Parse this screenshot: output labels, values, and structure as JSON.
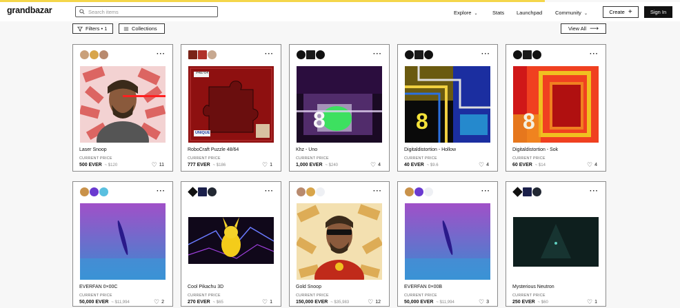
{
  "header": {
    "logo": "grandbazar",
    "search_placeholder": "Search items",
    "nav": {
      "explore": "Explore",
      "stats": "Stats",
      "launchpad": "Launchpad",
      "community": "Community"
    },
    "create_label": "Create",
    "signin_label": "Sign In"
  },
  "toolbar": {
    "filters_label": "Filters • 1",
    "collections_label": "Collections",
    "view_all_label": "View All"
  },
  "colors": {
    "accent": "#f4d64a",
    "dark": "#111111"
  },
  "cards": [
    {
      "title": "Laser Snoop",
      "price_label": "CURRENT PRICE",
      "price": "500 EVER",
      "usd": "~ $120",
      "likes": "11"
    },
    {
      "title": "RoboCraft Puzzle 48/64",
      "price_label": "CURRENT PRICE",
      "price": "777 EVER",
      "usd": "~ $186",
      "likes": "1"
    },
    {
      "title": "Khz - Uno",
      "price_label": "CURRENT PRICE",
      "price": "1,000 EVER",
      "usd": "~ $240",
      "likes": "4"
    },
    {
      "title": "Digitaldistortion - Hollow",
      "price_label": "CURRENT PRICE",
      "price": "40 EVER",
      "usd": "~ $9.6",
      "likes": "4"
    },
    {
      "title": "Digitaldistortion - Sok",
      "price_label": "CURRENT PRICE",
      "price": "60 EVER",
      "usd": "~ $14",
      "likes": "4"
    },
    {
      "title": "EVERFAN 0×00C",
      "price_label": "CURRENT PRICE",
      "price": "50,000 EVER",
      "usd": "~ $11,994",
      "likes": "2"
    },
    {
      "title": "Cool Pikachu 3D",
      "price_label": "CURRENT PRICE",
      "price": "270 EVER",
      "usd": "~ $65",
      "likes": "1"
    },
    {
      "title": "Gold Snoop",
      "price_label": "CURRENT PRICE",
      "price": "150,000 EVER",
      "usd": "~ $35,983",
      "likes": "12"
    },
    {
      "title": "EVERFAN 0×00B",
      "price_label": "CURRENT PRICE",
      "price": "50,000 EVER",
      "usd": "~ $11,994",
      "likes": "3"
    },
    {
      "title": "Mysterious Neutron",
      "price_label": "CURRENT PRICE",
      "price": "250 EVER",
      "usd": "~ $60",
      "likes": "1"
    }
  ],
  "art_labels": {
    "robocraft_badge": "#48/64",
    "robocraft_tag": "UNIQUE",
    "digit_glyph": "8"
  },
  "icons": {
    "search": "search-icon",
    "filter": "filter-icon",
    "collections": "list-icon",
    "arrow": "arrow-right-icon",
    "heart": "heart-icon",
    "more": "more-icon"
  }
}
